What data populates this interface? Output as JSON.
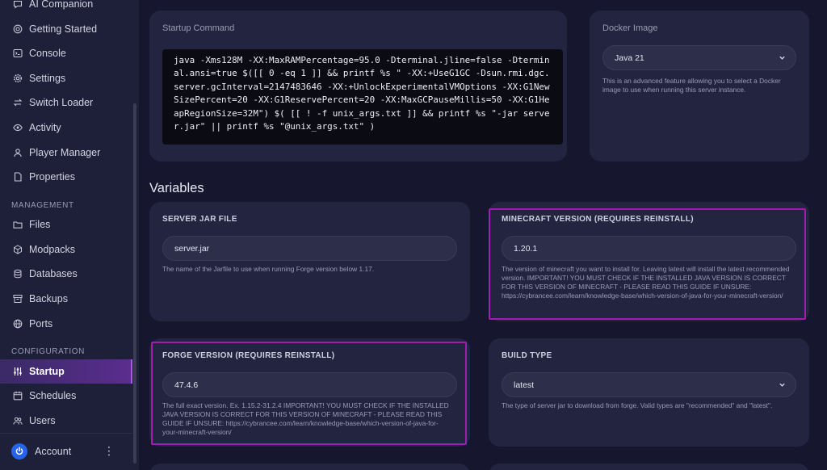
{
  "sidebar": {
    "items": [
      {
        "label": "AI Companion",
        "icon": "chat-icon"
      },
      {
        "label": "Getting Started",
        "icon": "lifebuoy-icon"
      },
      {
        "label": "Console",
        "icon": "terminal-icon"
      },
      {
        "label": "Settings",
        "icon": "gear-icon"
      },
      {
        "label": "Switch Loader",
        "icon": "arrows-swap-icon"
      },
      {
        "label": "Activity",
        "icon": "eye-icon"
      },
      {
        "label": "Player Manager",
        "icon": "user-icon"
      },
      {
        "label": "Properties",
        "icon": "file-icon"
      }
    ],
    "management_label": "MANAGEMENT",
    "management": [
      {
        "label": "Files",
        "icon": "folder-icon"
      },
      {
        "label": "Modpacks",
        "icon": "box-icon"
      },
      {
        "label": "Databases",
        "icon": "database-icon"
      },
      {
        "label": "Backups",
        "icon": "archive-icon"
      },
      {
        "label": "Ports",
        "icon": "globe-icon"
      }
    ],
    "configuration_label": "CONFIGURATION",
    "configuration": [
      {
        "label": "Startup",
        "icon": "sliders-icon",
        "active": true
      },
      {
        "label": "Schedules",
        "icon": "calendar-icon"
      },
      {
        "label": "Users",
        "icon": "users-icon"
      }
    ],
    "account_label": "Account",
    "kebab": "⋮"
  },
  "startup": {
    "title": "Startup Command",
    "command": "java -Xms128M -XX:MaxRAMPercentage=95.0 -Dterminal.jline=false -Dterminal.ansi=true $([[ 0 -eq 1 ]] && printf %s \" -XX:+UseG1GC -Dsun.rmi.dgc.server.gcInterval=2147483646 -XX:+UnlockExperimentalVMOptions -XX:G1NewSizePercent=20 -XX:G1ReservePercent=20 -XX:MaxGCPauseMillis=50 -XX:G1HeapRegionSize=32M\") $( [[ ! -f unix_args.txt ]] && printf %s \"-jar server.jar\" || printf %s \"@unix_args.txt\" )"
  },
  "docker": {
    "title": "Docker Image",
    "value": "Java 21",
    "help": "This is an advanced feature allowing you to select a Docker image to use when running this server instance."
  },
  "variables": {
    "heading": "Variables",
    "server_jar": {
      "label": "SERVER JAR FILE",
      "value": "server.jar",
      "help": "The name of the Jarfile to use when running Forge version below 1.17."
    },
    "minecraft_version": {
      "label": "MINECRAFT VERSION (REQUIRES REINSTALL)",
      "value": "1.20.1",
      "help": "The version of minecraft you want to install for. Leaving latest will install the latest recommended version. IMPORTANT! YOU MUST CHECK IF THE INSTALLED JAVA VERSION IS CORRECT FOR THIS VERSION OF MINECRAFT - PLEASE READ THIS GUIDE IF UNSURE: https://cybrancee.com/learn/knowledge-base/which-version-of-java-for-your-minecraft-version/"
    },
    "forge_version": {
      "label": "FORGE VERSION (REQUIRES REINSTALL)",
      "value": "47.4.6",
      "help": "The full exact version. Ex. 1.15.2-31.2.4 IMPORTANT! YOU MUST CHECK IF THE INSTALLED JAVA VERSION IS CORRECT FOR THIS VERSION OF MINECRAFT - PLEASE READ THIS GUIDE IF UNSURE: https://cybrancee.com/learn/knowledge-base/which-version-of-java-for-your-minecraft-version/"
    },
    "build_type": {
      "label": "BUILD TYPE",
      "value": "latest",
      "help": "The type of server jar to download from forge. Valid types are \"recommended\" and \"latest\"."
    }
  },
  "colors": {
    "highlight": "#a21caf",
    "active_nav": "#5b2d8f",
    "accent": "#a855f7"
  }
}
